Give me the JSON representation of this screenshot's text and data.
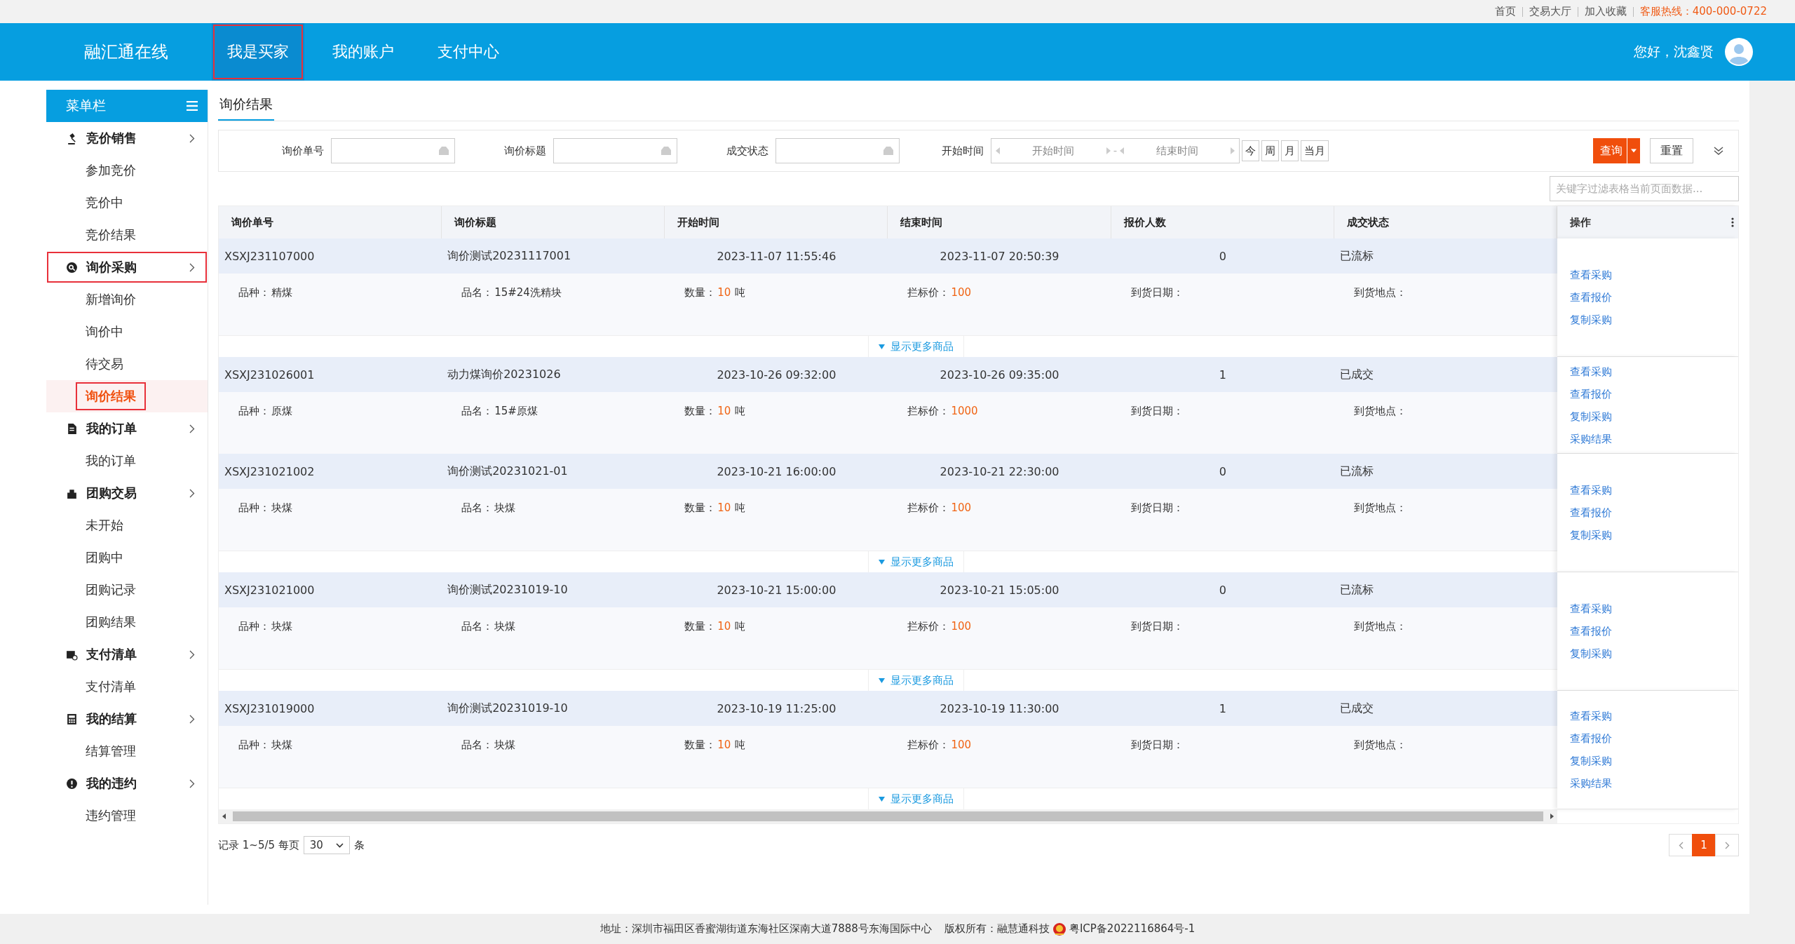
{
  "top_links": [
    {
      "label": "首页"
    },
    {
      "label": "交易大厅"
    },
    {
      "label": "加入收藏"
    }
  ],
  "hotline": "客服热线：400-000-0722",
  "brand": "融汇通在线",
  "nav_tabs": [
    {
      "label": "我是买家",
      "selected": true,
      "outlined": true
    },
    {
      "label": "我的账户",
      "selected": false,
      "outlined": false
    },
    {
      "label": "支付中心",
      "selected": false,
      "outlined": false
    }
  ],
  "greeting": "您好，沈鑫贤",
  "sidebar": {
    "title": "菜单栏",
    "groups": [
      {
        "label": "竞价销售",
        "kind": "auction",
        "outlined": false,
        "children": [
          {
            "label": "参加竞价",
            "selected": false,
            "outlined": false
          },
          {
            "label": "竞价中",
            "selected": false,
            "outlined": false
          },
          {
            "label": "竞价结果",
            "selected": false,
            "outlined": false
          }
        ]
      },
      {
        "label": "询价采购",
        "kind": "inquiry",
        "outlined": true,
        "children": [
          {
            "label": "新增询价",
            "selected": false,
            "outlined": false
          },
          {
            "label": "询价中",
            "selected": false,
            "outlined": false
          },
          {
            "label": "待交易",
            "selected": false,
            "outlined": false
          },
          {
            "label": "询价结果",
            "selected": true,
            "outlined": true
          }
        ]
      },
      {
        "label": "我的订单",
        "kind": "order",
        "outlined": false,
        "children": [
          {
            "label": "我的订单",
            "selected": false,
            "outlined": false
          }
        ]
      },
      {
        "label": "团购交易",
        "kind": "group",
        "outlined": false,
        "children": [
          {
            "label": "未开始",
            "selected": false,
            "outlined": false
          },
          {
            "label": "团购中",
            "selected": false,
            "outlined": false
          },
          {
            "label": "团购记录",
            "selected": false,
            "outlined": false
          },
          {
            "label": "团购结果",
            "selected": false,
            "outlined": false
          }
        ]
      },
      {
        "label": "支付清单",
        "kind": "payment",
        "outlined": false,
        "children": [
          {
            "label": "支付清单",
            "selected": false,
            "outlined": false
          }
        ]
      },
      {
        "label": "我的结算",
        "kind": "settlement",
        "outlined": false,
        "children": [
          {
            "label": "结算管理",
            "selected": false,
            "outlined": false
          }
        ]
      },
      {
        "label": "我的违约",
        "kind": "breach",
        "outlined": false,
        "children": [
          {
            "label": "违约管理",
            "selected": false,
            "outlined": false
          }
        ]
      }
    ]
  },
  "page_tab": "询价结果",
  "filters": [
    {
      "label": "询价单号"
    },
    {
      "label": "询价标题"
    },
    {
      "label": "成交状态"
    }
  ],
  "date_filter": {
    "label": "开始时间",
    "start_placeholder": "开始时间",
    "separator": "-",
    "end_placeholder": "结束时间"
  },
  "quick_ranges": [
    "今",
    "周",
    "月",
    "当月"
  ],
  "query_button": "查询",
  "reset_button": "重置",
  "table_search": {
    "placeholder": "关键字过滤表格当前页面数据..."
  },
  "columns": [
    "询价单号",
    "询价标题",
    "开始时间",
    "结束时间",
    "报价人数",
    "成交状态"
  ],
  "actions_header": "操作",
  "records": [
    {
      "id": "XSXJ231107000",
      "title": "询价测试20231117001",
      "start": "2023-11-07 11:55:46",
      "end": "2023-11-07 20:50:39",
      "bidders": "0",
      "status": "已流标",
      "details": [
        {
          "label": "品种：",
          "value": "精煤",
          "kind": "text"
        },
        {
          "label": "品名：",
          "value": "15#24洗精块",
          "kind": "text"
        },
        {
          "label": "数量：",
          "value": "10",
          "unit": "吨",
          "kind": "amount"
        },
        {
          "label": "拦标价：",
          "value": "100",
          "kind": "amount"
        },
        {
          "label": "到货日期："
        },
        {
          "label": "到货地点："
        }
      ],
      "more": "显示更多商品",
      "actions": [
        "查看采购",
        "查看报价",
        "复制采购"
      ]
    },
    {
      "id": "XSXJ231026001",
      "title": "动力煤询价20231026",
      "start": "2023-10-26 09:32:00",
      "end": "2023-10-26 09:35:00",
      "bidders": "1",
      "status": "已成交",
      "details": [
        {
          "label": "品种：",
          "value": "原煤",
          "kind": "text"
        },
        {
          "label": "品名：",
          "value": "15#原煤",
          "kind": "text"
        },
        {
          "label": "数量：",
          "value": "10",
          "unit": "吨",
          "kind": "amount"
        },
        {
          "label": "拦标价：",
          "value": "1000",
          "kind": "amount"
        },
        {
          "label": "到货日期："
        },
        {
          "label": "到货地点："
        }
      ],
      "actions": [
        "查看采购",
        "查看报价",
        "复制采购",
        "采购结果"
      ]
    },
    {
      "id": "XSXJ231021002",
      "title": "询价测试20231021-01",
      "start": "2023-10-21 16:00:00",
      "end": "2023-10-21 22:30:00",
      "bidders": "0",
      "status": "已流标",
      "details": [
        {
          "label": "品种：",
          "value": "块煤",
          "kind": "text"
        },
        {
          "label": "品名：",
          "value": "块煤",
          "kind": "text"
        },
        {
          "label": "数量：",
          "value": "10",
          "unit": "吨",
          "kind": "amount"
        },
        {
          "label": "拦标价：",
          "value": "100",
          "kind": "amount"
        },
        {
          "label": "到货日期："
        },
        {
          "label": "到货地点："
        }
      ],
      "more": "显示更多商品",
      "actions": [
        "查看采购",
        "查看报价",
        "复制采购"
      ]
    },
    {
      "id": "XSXJ231021000",
      "title": "询价测试20231019-10",
      "start": "2023-10-21 15:00:00",
      "end": "2023-10-21 15:05:00",
      "bidders": "0",
      "status": "已流标",
      "details": [
        {
          "label": "品种：",
          "value": "块煤",
          "kind": "text"
        },
        {
          "label": "品名：",
          "value": "块煤",
          "kind": "text"
        },
        {
          "label": "数量：",
          "value": "10",
          "unit": "吨",
          "kind": "amount"
        },
        {
          "label": "拦标价：",
          "value": "100",
          "kind": "amount"
        },
        {
          "label": "到货日期："
        },
        {
          "label": "到货地点："
        }
      ],
      "more": "显示更多商品",
      "actions": [
        "查看采购",
        "查看报价",
        "复制采购"
      ]
    },
    {
      "id": "XSXJ231019000",
      "title": "询价测试20231019-10",
      "start": "2023-10-19 11:25:00",
      "end": "2023-10-19 11:30:00",
      "bidders": "1",
      "status": "已成交",
      "details": [
        {
          "label": "品种：",
          "value": "块煤",
          "kind": "text"
        },
        {
          "label": "品名：",
          "value": "块煤",
          "kind": "text"
        },
        {
          "label": "数量：",
          "value": "10",
          "unit": "吨",
          "kind": "amount"
        },
        {
          "label": "拦标价：",
          "value": "100",
          "kind": "amount"
        },
        {
          "label": "到货日期："
        },
        {
          "label": "到货地点："
        }
      ],
      "more": "显示更多商品",
      "actions": [
        "查看采购",
        "查看报价",
        "复制采购",
        "采购结果"
      ]
    }
  ],
  "pagination": {
    "summary": "记录 1~5/5 每页",
    "page_size": "30",
    "unit": "条",
    "pages": [
      {
        "label": "1",
        "selected": true
      }
    ]
  },
  "footer": {
    "address": "地址：深圳市福田区香蜜湖街道东海社区深南大道7888号东海国际中心",
    "copyright": "版权所有：融慧通科技",
    "icp": "粤ICP备2022116864号-1"
  }
}
